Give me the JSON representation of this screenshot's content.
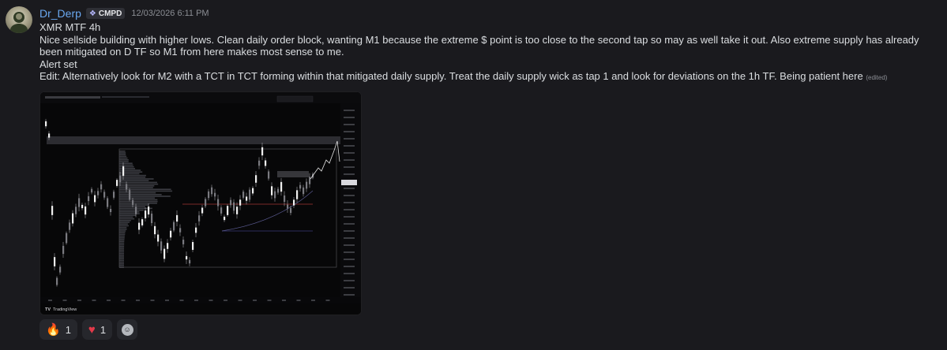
{
  "message": {
    "author": "Dr_Derp",
    "tag": "CMPD",
    "timestamp": "12/03/2026 6:11 PM",
    "lines": [
      "XMR MTF 4h",
      "Nice sellside building with higher lows. Clean daily order block, wanting M1 because the extreme $ point is too close to the second tap so may as well take it out. Also extreme supply has already been mitigated on D TF so M1 from here makes most sense to me.",
      "Alert set"
    ],
    "edit_line": "Edit: Alternatively look for M2 with a TCT in TCT forming within that mitigated daily supply. Treat the daily supply wick as tap 1 and look for deviations on the 1h TF. Being patient here",
    "edited_marker": "(edited)"
  },
  "attachment": {
    "watermark": "TradingView"
  },
  "reactions": [
    {
      "icon": "fire-icon",
      "count": "1"
    },
    {
      "icon": "heart-icon",
      "count": "1"
    }
  ],
  "colors": {
    "username": "#6aa8f0",
    "background": "#1a1a1e",
    "chart_background": "#070708"
  }
}
